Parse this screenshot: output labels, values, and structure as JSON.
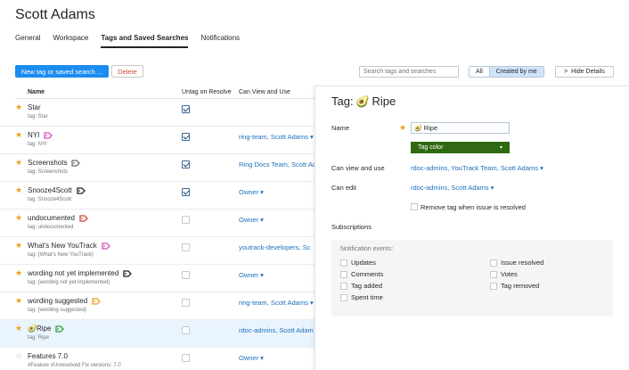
{
  "page": {
    "title": "Scott Adams"
  },
  "tabs": [
    {
      "label": "General",
      "active": false
    },
    {
      "label": "Workspace",
      "active": false
    },
    {
      "label": "Tags and Saved Searches",
      "active": true
    },
    {
      "label": "Notifications",
      "active": false
    }
  ],
  "toolbar": {
    "new_label": "New tag or saved search ...",
    "delete_label": "Delete",
    "search_placeholder": "Search tags and searches",
    "filter_all": "All",
    "filter_created": "Created by me",
    "hide_details": "Hide Details",
    "hide_details_icon": "chevron-right-icon"
  },
  "table": {
    "headers": {
      "name": "Name",
      "untag": "Untag on Resolve",
      "can_view": "Can View and Use"
    },
    "rows": [
      {
        "name": "Star",
        "sub": "tag: Star",
        "starred": true,
        "untag": true,
        "can_view": "",
        "tag_color": ""
      },
      {
        "name": "NYI",
        "sub": "tag: NYI",
        "starred": true,
        "untag": true,
        "can_view": "ring-team, Scott Adams ▾",
        "tag_color": "#d94fb5"
      },
      {
        "name": "Screenshots",
        "sub": "tag: Screenshots",
        "starred": true,
        "untag": true,
        "can_view": "Ring Docs Team, Scott Ad",
        "tag_color": "#6b6f73"
      },
      {
        "name": "Snooze4Scott",
        "sub": "tag: Snooze4Scott",
        "starred": true,
        "untag": true,
        "can_view": "Owner ▾",
        "tag_color": "#1f2326"
      },
      {
        "name": "undocumented",
        "sub": "tag: undocumented",
        "starred": true,
        "untag": false,
        "can_view": "Owner ▾",
        "tag_color": "#d1473b"
      },
      {
        "name": "What's New YouTrack",
        "sub": "tag: {What's New YouTrack}",
        "starred": true,
        "untag": false,
        "can_view": "youtrack-developers, Sc",
        "tag_color": "#d94fb5"
      },
      {
        "name": "wording not yet implemented",
        "sub": "tag: {wording not yet implemented}",
        "starred": true,
        "untag": false,
        "can_view": "Owner ▾",
        "tag_color": "#1f2326"
      },
      {
        "name": "wording suggested",
        "sub": "tag: {wording suggested}",
        "starred": true,
        "untag": false,
        "can_view": "ring-team, Scott Adams ▾",
        "tag_color": "#e9a21f"
      },
      {
        "name": "Ripe",
        "sub": "tag: Ripe",
        "starred": true,
        "untag": false,
        "can_view": "rdoc-admins, Scott Adam",
        "tag_color": "#2f9a3a",
        "emoji": "🥑",
        "selected": true
      },
      {
        "name": "Features 7.0",
        "sub": "#Feature #Unresolved Fix versions: 7.0",
        "starred": false,
        "untag": false,
        "can_view": "Owner ▾",
        "tag_color": ""
      }
    ]
  },
  "details": {
    "title_prefix": "Tag:",
    "emoji": "🥑",
    "tag_name": "Ripe",
    "name_label": "Name",
    "name_value": "Ripe",
    "tag_color_label": "Tag color",
    "tag_color": "#2f6912",
    "can_view_label": "Can view and use",
    "can_view_value": "rdoc-admins, YouTrack Team, Scott Adams ▾",
    "can_edit_label": "Can edit",
    "can_edit_value": "rdoc-admins, Scott Adams ▾",
    "remove_tag_label": "Remove tag when issue is resolved",
    "subscriptions_label": "Subscriptions",
    "notification_events_label": "Notification events:",
    "events_left": [
      "Updates",
      "Comments",
      "Tag added",
      "Spent time"
    ],
    "events_right": [
      "Issue resolved",
      "Votes",
      "Tag removed"
    ]
  }
}
